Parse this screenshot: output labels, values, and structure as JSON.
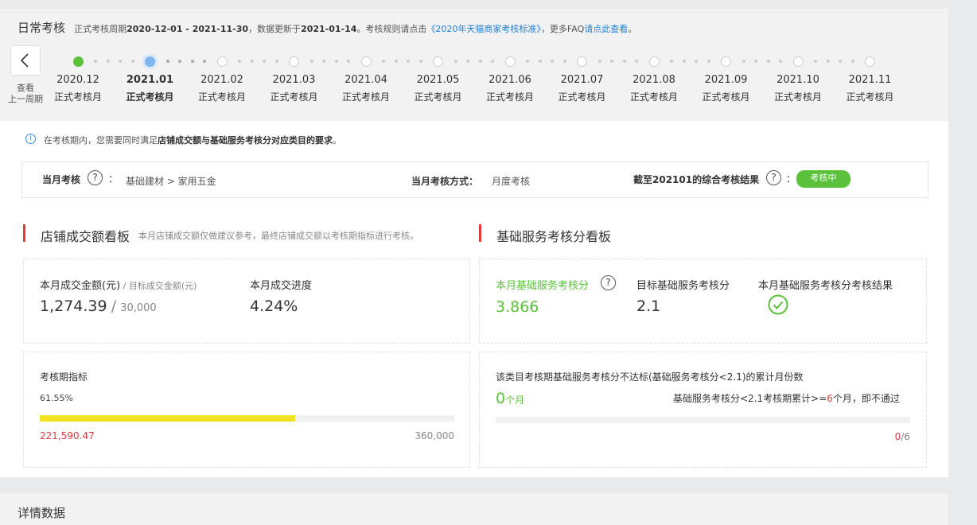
{
  "header": {
    "title": "日常考核",
    "period_prefix": "正式考核周期",
    "period_range": "2020-12-01 - 2021-11-30",
    "update_prefix": "，数据更新于",
    "update_date": "2021-01-14",
    "rule_text": "。考核规则请点击",
    "rule_link": "《2020年天猫商家考核标准》",
    "faq_text": "，更多FAQ",
    "faq_link": "请点此查看",
    "faq_end": "。"
  },
  "timeline": {
    "prev_label_line1": "查看",
    "prev_label_line2": "上一周期",
    "months": [
      {
        "month": "2020.12",
        "label": "正式考核月",
        "state": "done"
      },
      {
        "month": "2021.01",
        "label": "正式考核月",
        "state": "current"
      },
      {
        "month": "2021.02",
        "label": "正式考核月",
        "state": "future"
      },
      {
        "month": "2021.03",
        "label": "正式考核月",
        "state": "future"
      },
      {
        "month": "2021.04",
        "label": "正式考核月",
        "state": "future"
      },
      {
        "month": "2021.05",
        "label": "正式考核月",
        "state": "future"
      },
      {
        "month": "2021.06",
        "label": "正式考核月",
        "state": "future"
      },
      {
        "month": "2021.07",
        "label": "正式考核月",
        "state": "future"
      },
      {
        "month": "2021.08",
        "label": "正式考核月",
        "state": "future"
      },
      {
        "month": "2021.09",
        "label": "正式考核月",
        "state": "future"
      },
      {
        "month": "2021.10",
        "label": "正式考核月",
        "state": "future"
      },
      {
        "month": "2021.11",
        "label": "正式考核月",
        "state": "future"
      }
    ]
  },
  "notice": {
    "pre": "在考核期内，您需要同时满足",
    "bold": "店铺成交额与基础服务考核分对应类目的要求",
    "post": "。"
  },
  "summary": {
    "month_label": "当月考核",
    "colon": "：",
    "category": "基础建材 > 家用五金",
    "method_label": "当月考核方式：",
    "method_value": "月度考核",
    "result_label": "截至202101的综合考核结果",
    "result_colon": "：",
    "result_badge": "考核中"
  },
  "sales_board": {
    "title": "店铺成交额看板",
    "note": "本月店铺成交额仅做建议参考，最终店铺成交额以考核期指标进行考核。",
    "amount_label": "本月成交金额(元)",
    "target_label": " / 目标成交金额(元)",
    "amount_value": "1,274.39",
    "slash": "/",
    "target_value": "30,000",
    "progress_label": "本月成交进度",
    "progress_value": "4.24%",
    "period_label": "考核期指标",
    "period_percent": "61.55%",
    "period_fraction": 0.6155,
    "period_current": "221,590.47",
    "period_target": "360,000"
  },
  "service_board": {
    "title": "基础服务考核分看板",
    "score_label": "本月基础服务考核分",
    "score_value": "3.866",
    "target_label": "目标基础服务考核分",
    "target_value": "2.1",
    "result_label": "本月基础服务考核分考核结果",
    "fail_title": "该类目考核期基础服务考核分不达标(基础服务考核分<2.1)的累计月份数",
    "fail_count": "0",
    "fail_unit": "个月",
    "rule_pre": "基础服务考核分<2.1考核期累计>=",
    "rule_num": "6",
    "rule_post": "个月，即不通过",
    "progress_num": "0",
    "progress_den": "/6",
    "progress_fraction": 0
  },
  "detail": {
    "title": "详情数据"
  },
  "colors": {
    "accent_green": "#5bc13b",
    "accent_red": "#e4393c",
    "progress_yellow": "#f1e323",
    "link_blue": "#1e7fd6"
  }
}
